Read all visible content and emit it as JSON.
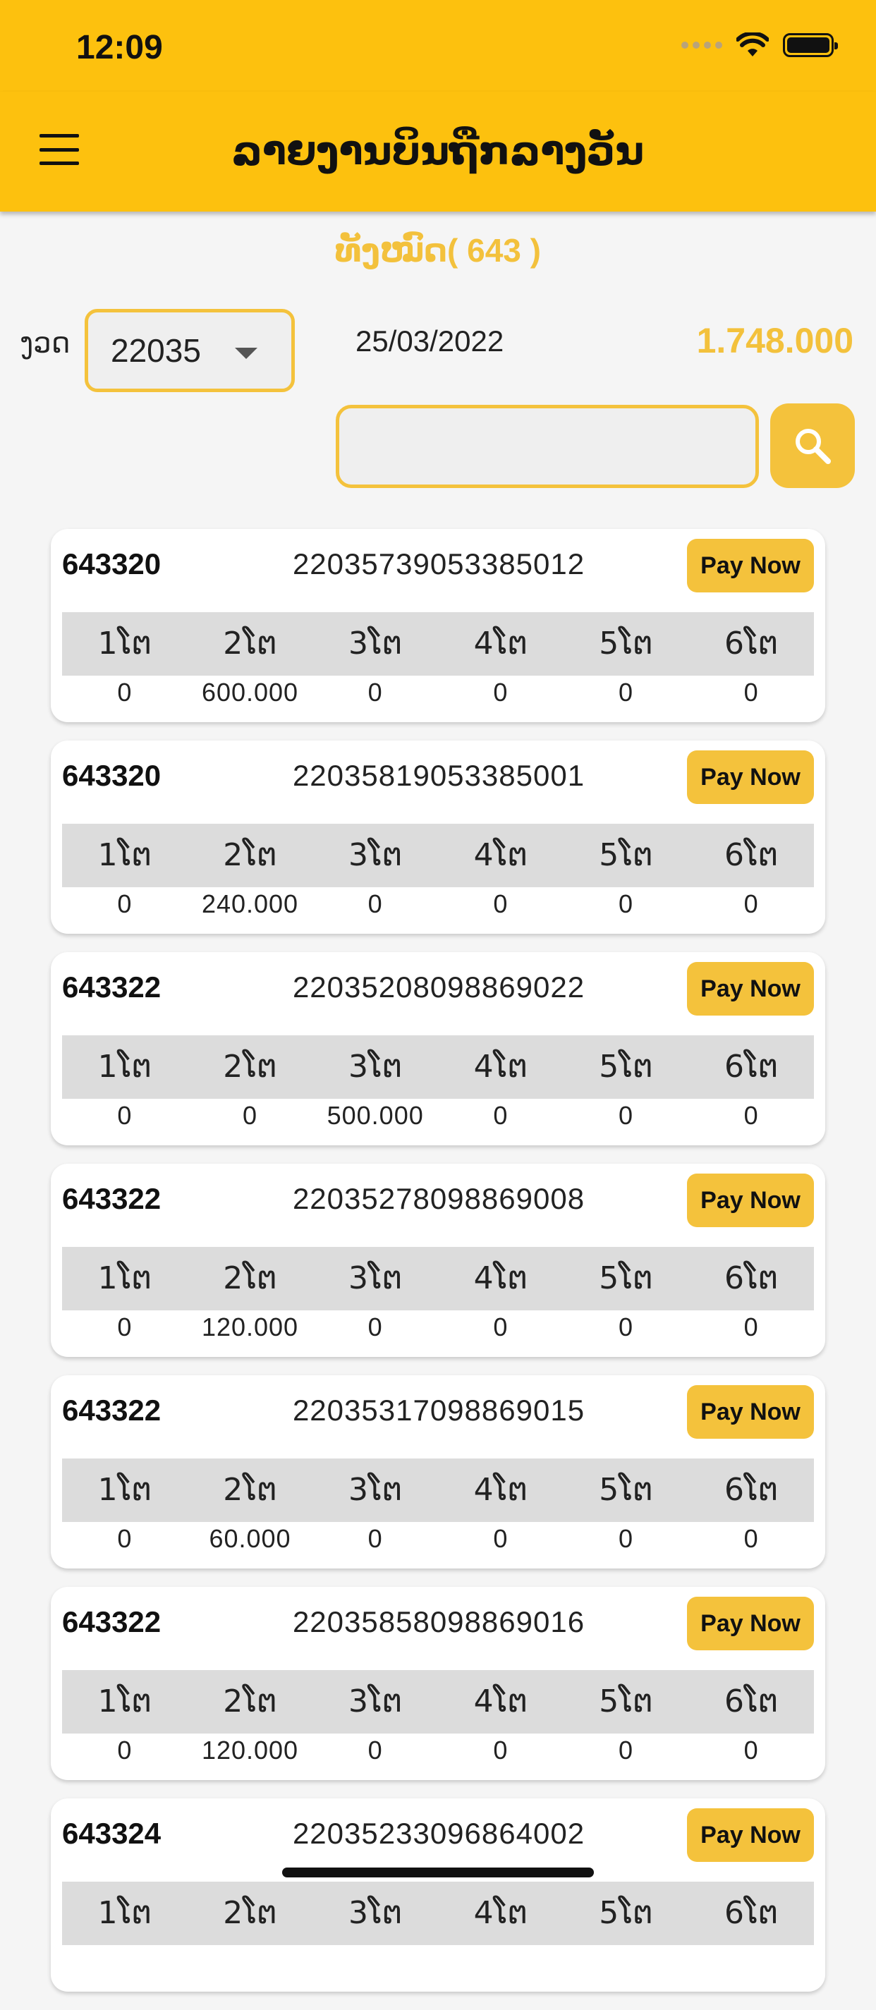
{
  "status_bar": {
    "time": "12:09"
  },
  "app_bar": {
    "title": "ລາຍງານບິນຖືກລາງວັນ"
  },
  "summary": {
    "text": "ທັງໝົດ( 643 )"
  },
  "filters": {
    "draw_label": "ງວດ",
    "draw_value": "22035",
    "date": "25/03/2022",
    "total": "1.748.000",
    "search_placeholder": ""
  },
  "prize_headers": [
    "1ໂຕ",
    "2ໂຕ",
    "3ໂຕ",
    "4ໂຕ",
    "5ໂຕ",
    "6ໂຕ"
  ],
  "pay_label": "Pay Now",
  "tickets": [
    {
      "code": "643320",
      "ticket": "22035739053385012",
      "values": [
        "0",
        "600.000",
        "0",
        "0",
        "0",
        "0"
      ]
    },
    {
      "code": "643320",
      "ticket": "22035819053385001",
      "values": [
        "0",
        "240.000",
        "0",
        "0",
        "0",
        "0"
      ]
    },
    {
      "code": "643322",
      "ticket": "22035208098869022",
      "values": [
        "0",
        "0",
        "500.000",
        "0",
        "0",
        "0"
      ]
    },
    {
      "code": "643322",
      "ticket": "22035278098869008",
      "values": [
        "0",
        "120.000",
        "0",
        "0",
        "0",
        "0"
      ]
    },
    {
      "code": "643322",
      "ticket": "22035317098869015",
      "values": [
        "0",
        "60.000",
        "0",
        "0",
        "0",
        "0"
      ]
    },
    {
      "code": "643322",
      "ticket": "22035858098869016",
      "values": [
        "0",
        "120.000",
        "0",
        "0",
        "0",
        "0"
      ]
    },
    {
      "code": "643324",
      "ticket": "22035233096864002",
      "values": [
        "",
        "",
        "",
        "",
        "",
        ""
      ]
    }
  ]
}
